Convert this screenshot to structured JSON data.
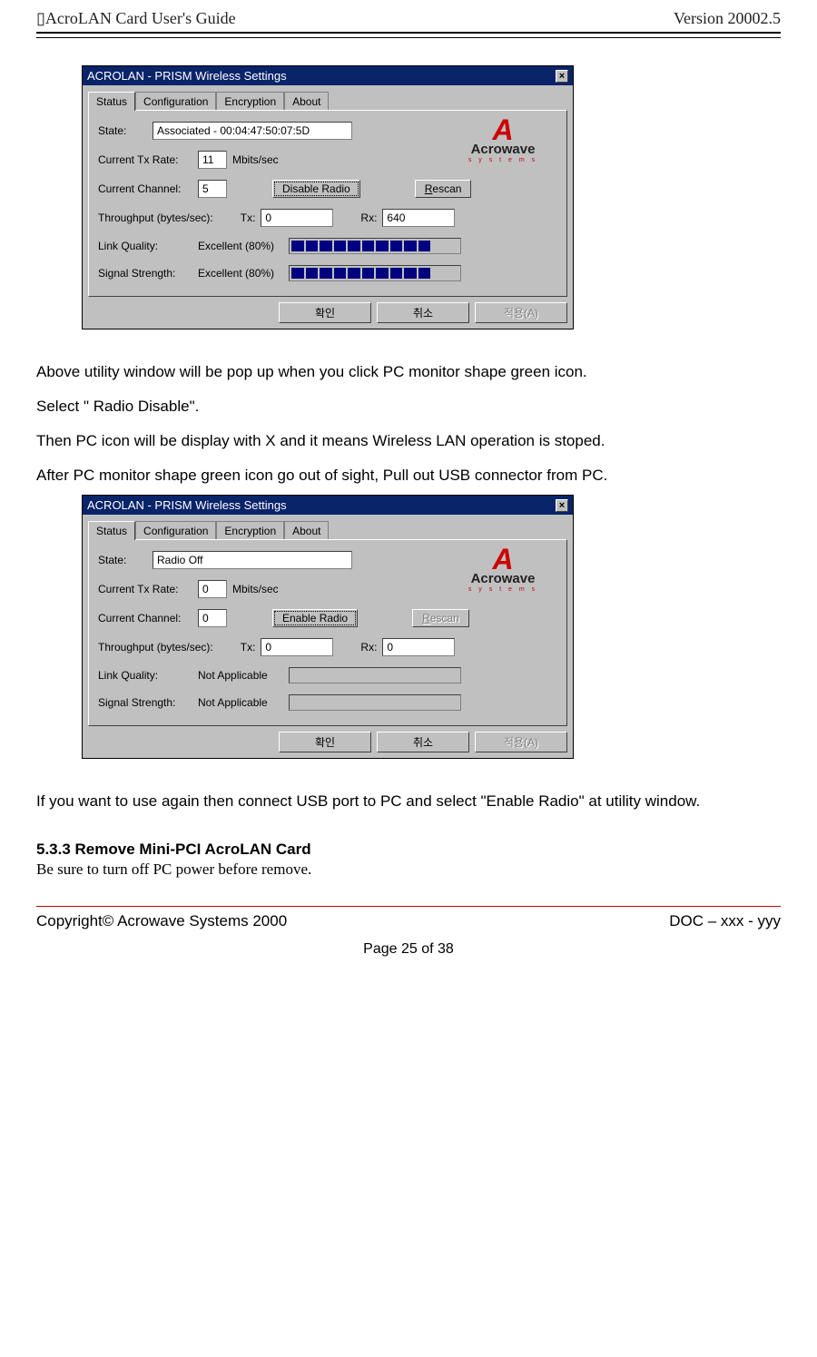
{
  "header": {
    "left": "▯AcroLAN Card User's Guide",
    "right": "Version 20002.5"
  },
  "win_common": {
    "title": "ACROLAN - PRISM Wireless Settings",
    "tabs": [
      "Status",
      "Configuration",
      "Encryption",
      "About"
    ],
    "labels": {
      "state": "State:",
      "txrate": "Current Tx Rate:",
      "txrate_unit": "Mbits/sec",
      "channel": "Current Channel:",
      "throughput": "Throughput (bytes/sec):",
      "tx": "Tx:",
      "rx": "Rx:",
      "link": "Link Quality:",
      "signal": "Signal Strength:"
    },
    "buttons": {
      "rescan": "Rescan",
      "ok": "확인",
      "cancel": "취소",
      "apply": "적용(A)"
    },
    "logo": {
      "mark": "A",
      "name": "Acrowave",
      "sub": "s y s t e m s"
    }
  },
  "win1": {
    "state": "Associated - 00:04:47:50:07:5D",
    "txrate": "11",
    "channel": "5",
    "radio_btn": "Disable Radio",
    "tx": "0",
    "rx": "640",
    "link_text": "Excellent (80%)",
    "signal_text": "Excellent (80%)",
    "bars_total": 12,
    "bars_filled": 10
  },
  "win2": {
    "state": "Radio Off",
    "txrate": "0",
    "channel": "0",
    "radio_btn": "Enable Radio",
    "tx": "0",
    "rx": "0",
    "link_text": "Not Applicable",
    "signal_text": "Not Applicable",
    "bars_total": 0,
    "bars_filled": 0
  },
  "body": {
    "p1": "Above utility window will be pop up when you click PC monitor shape green icon.",
    "p2": "Select \" Radio Disable\".",
    "p3": "Then PC icon will be display with X and it means Wireless LAN operation is stoped.",
    "p4": "After PC monitor shape green icon go out of sight, Pull out USB connector from PC.",
    "p5": "If you want to use again then connect USB port to PC and select \"Enable Radio\" at utility window."
  },
  "section": {
    "title": "5.3.3 Remove Mini-PCI AcroLAN Card",
    "note": " Be sure to turn off PC power before remove."
  },
  "footer": {
    "left": "Copyright© Acrowave Systems 2000",
    "right": "DOC – xxx - yyy",
    "page": "Page 25 of 38"
  }
}
